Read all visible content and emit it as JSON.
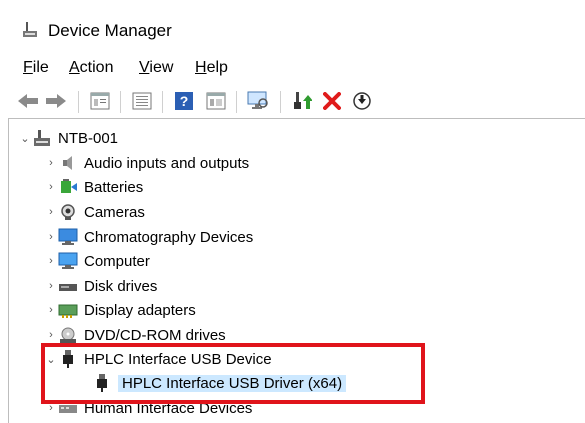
{
  "window": {
    "title": "Device Manager"
  },
  "menu": [
    {
      "label": "File",
      "underline": "F"
    },
    {
      "label": "Action",
      "underline": "A"
    },
    {
      "label": "View",
      "underline": "V"
    },
    {
      "label": "Help",
      "underline": "H"
    }
  ],
  "toolbar": {
    "icons": [
      "back-arrow-icon",
      "forward-arrow-icon",
      "properties-icon",
      "list-icon",
      "help-icon",
      "console-icon",
      "scan-hardware-icon",
      "update-driver-icon",
      "uninstall-icon",
      "disable-device-icon"
    ]
  },
  "tree": {
    "root": "NTB-001",
    "items": [
      {
        "label": "Audio inputs and outputs",
        "icon": "speaker-icon"
      },
      {
        "label": "Batteries",
        "icon": "battery-icon"
      },
      {
        "label": "Cameras",
        "icon": "camera-icon"
      },
      {
        "label": "Chromatography Devices",
        "icon": "monitor-icon"
      },
      {
        "label": "Computer",
        "icon": "computer-icon"
      },
      {
        "label": "Disk drives",
        "icon": "disk-drive-icon"
      },
      {
        "label": "Display adapters",
        "icon": "display-adapter-icon"
      },
      {
        "label": "DVD/CD-ROM drives",
        "icon": "dvd-drive-icon"
      },
      {
        "label": "HPLC Interface USB Device",
        "icon": "usb-plug-icon",
        "expanded": true
      },
      {
        "label": "HPLC Interface USB Driver (x64)",
        "icon": "usb-plug-icon",
        "child": true,
        "selected": true
      },
      {
        "label": "Human Interface Devices",
        "icon": "hid-icon"
      }
    ]
  },
  "colors": {
    "highlight": "#e0141b",
    "selection": "#cce8ff"
  }
}
